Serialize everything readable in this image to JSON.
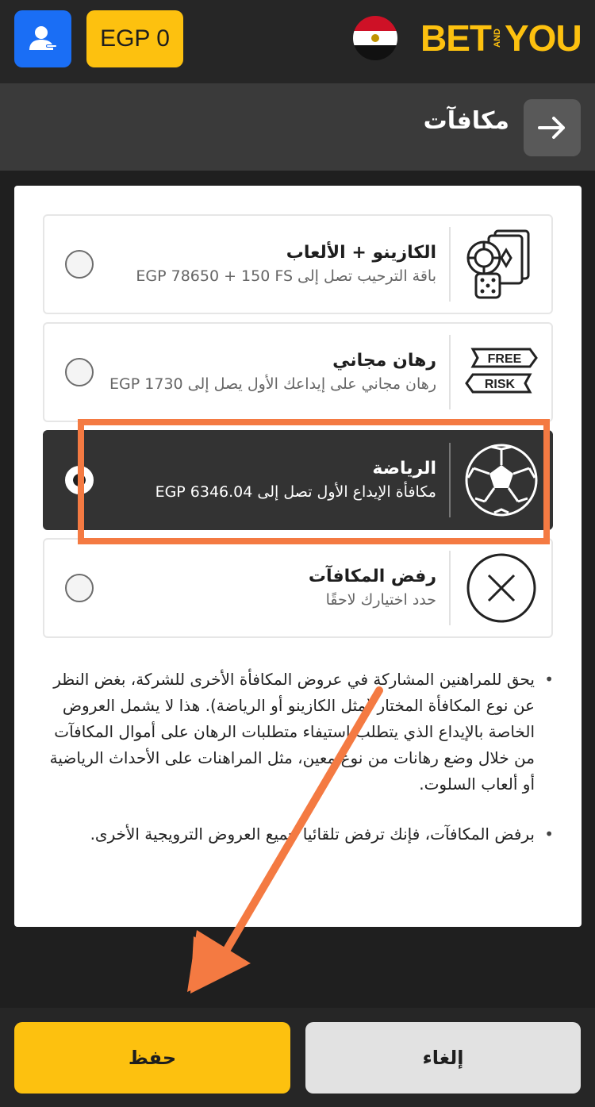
{
  "header": {
    "balance": "EGP 0",
    "logo": {
      "left": "BET",
      "mid": "AND",
      "right": "YOU"
    },
    "colors": {
      "user_button": "#1a6ef5",
      "accent": "#fdc10f"
    }
  },
  "page": {
    "title": "مكافآت"
  },
  "options": [
    {
      "title": "الكازينو + الألعاب",
      "subtitle": "باقة الترحيب تصل إلى EGP 78650 + 150 FS",
      "icon": "cards-dice-chip-icon",
      "selected": false
    },
    {
      "title": "رهان مجاني",
      "subtitle": "رهان مجاني على إيداعك الأول يصل إلى 1730 EGP",
      "icon": "free-risk-icon",
      "icon_text": [
        "FREE",
        "RISK"
      ],
      "selected": false
    },
    {
      "title": "الرياضة",
      "subtitle": "مكافأة الإيداع الأول تصل إلى EGP 6346.04",
      "icon": "football-icon",
      "selected": true
    },
    {
      "title": "رفض المكافآت",
      "subtitle": "حدد اختيارك لاحقًا",
      "icon": "close-circle-icon",
      "selected": false
    }
  ],
  "notes": [
    "يحق للمراهنين المشاركة في عروض المكافأة الأخرى للشركة، بغض النظر عن نوع المكافأة المختار (مثل الكازينو أو الرياضة). هذا لا يشمل العروض الخاصة بالإيداع الذي يتطلب إستيفاء متطلبات الرهان على أموال المكافآت من خلال وضع رهانات من نوع معين، مثل المراهنات على الأحداث الرياضية أو ألعاب السلوت.",
    "برفض المكافآت، فإنك ترفض تلقائيا جميع العروض الترويجية الأخرى."
  ],
  "footer": {
    "save_label": "حفظ",
    "cancel_label": "إلغاء"
  }
}
